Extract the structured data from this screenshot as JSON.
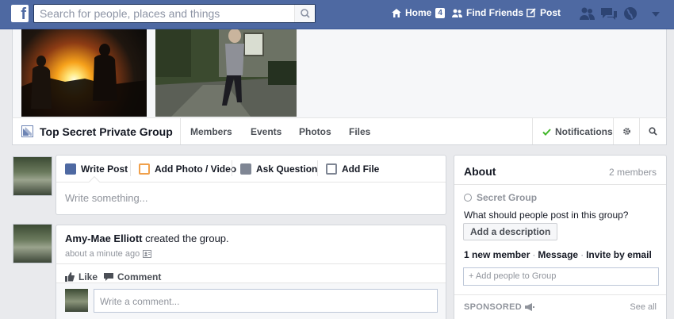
{
  "topbar": {
    "logo": "f",
    "search_placeholder": "Search for people, places and things",
    "home_label": "Home",
    "home_count": "4",
    "find_friends_label": "Find Friends",
    "post_label": "Post"
  },
  "group": {
    "title": "Top Secret Private Group",
    "tabs": [
      "Members",
      "Events",
      "Photos",
      "Files"
    ],
    "notifications_label": "Notifications"
  },
  "composer": {
    "tabs": [
      "Write Post",
      "Add Photo / Video",
      "Ask Question",
      "Add File"
    ],
    "placeholder": "Write something..."
  },
  "story": {
    "author": "Amy-Mae Elliott",
    "action_text": " created the group.",
    "time": "about a minute ago",
    "like_label": "Like",
    "comment_label": "Comment",
    "comment_placeholder": "Write a comment..."
  },
  "about": {
    "title": "About",
    "member_count": "2 members",
    "privacy": "Secret Group",
    "question": "What should people post in this group?",
    "add_description": "Add a description",
    "new_member": "1 new member",
    "message": "Message",
    "invite": "Invite by email",
    "add_people_placeholder": "+ Add people to Group",
    "sponsored": "SPONSORED",
    "see_all": "See all"
  },
  "colors": {
    "topbar": "#4e69a2",
    "background": "#e9eaed",
    "link": "#4b4f56",
    "check": "#42b72a"
  }
}
